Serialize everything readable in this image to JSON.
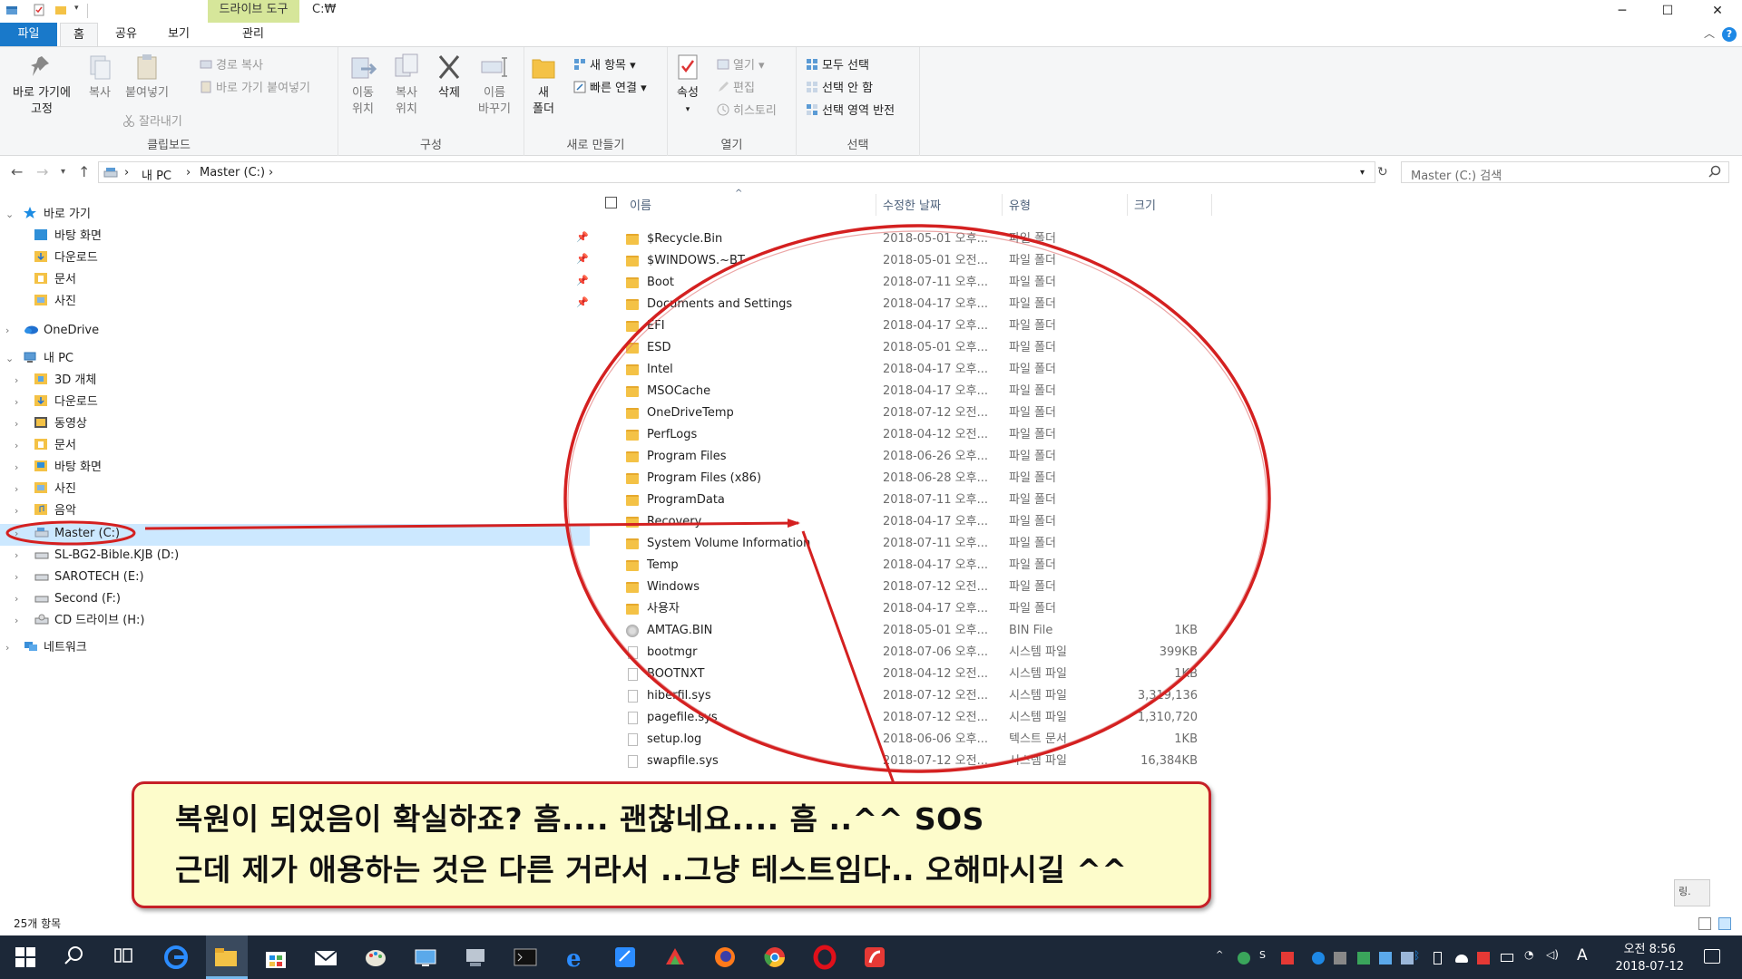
{
  "titlebar": {
    "context_tab": "드라이브 도구",
    "path": "C:₩",
    "minimize": "─",
    "maximize": "☐",
    "close": "✕"
  },
  "tabs": {
    "file": "파일",
    "home": "홈",
    "share": "공유",
    "view": "보기",
    "manage": "관리"
  },
  "ribbon": {
    "clipboard": {
      "label": "클립보드",
      "pin_line1": "바로 가기에",
      "pin_line2": "고정",
      "copy": "복사",
      "paste": "붙여넣기",
      "copy_path": "경로 복사",
      "paste_shortcut": "바로 가기 붙여넣기",
      "cut": "잘라내기"
    },
    "organize": {
      "label": "구성",
      "move_line1": "이동",
      "move_line2": "위치",
      "copyto_line1": "복사",
      "copyto_line2": "위치",
      "delete": "삭제",
      "rename_line1": "이름",
      "rename_line2": "바꾸기"
    },
    "new": {
      "label": "새로 만들기",
      "new_folder_line1": "새",
      "new_folder_line2": "폴더",
      "new_item": "새 항목",
      "easy_access": "빠른 연결"
    },
    "open": {
      "label": "열기",
      "properties": "속성",
      "open": "열기",
      "edit": "편집",
      "history": "히스토리"
    },
    "select": {
      "label": "선택",
      "select_all": "모두 선택",
      "select_none": "선택 안 함",
      "invert": "선택 영역 반전"
    }
  },
  "address": {
    "crumbs": [
      "내 PC",
      "Master (C:)"
    ],
    "search_placeholder": "Master (C:) 검색"
  },
  "navpane": {
    "quick_access": "바로 가기",
    "quick_items": [
      "바탕 화면",
      "다운로드",
      "문서",
      "사진"
    ],
    "onedrive": "OneDrive",
    "this_pc": "내 PC",
    "pc_items": [
      "3D 개체",
      "다운로드",
      "동영상",
      "문서",
      "바탕 화면",
      "사진",
      "음악"
    ],
    "drives": [
      "Master (C:)",
      "SL-BG2-Bible.KJB (D:)",
      "SAROTECH (E:)",
      "Second (F:)",
      "CD 드라이브 (H:)"
    ],
    "network": "네트워크"
  },
  "columns": {
    "name": "이름",
    "date": "수정한 날짜",
    "type": "유형",
    "size": "크기"
  },
  "files": [
    {
      "name": "$Recycle.Bin",
      "date": "2018-05-01 오후...",
      "type": "파일 폴더",
      "size": "",
      "kind": "folder"
    },
    {
      "name": "$WINDOWS.~BT",
      "date": "2018-05-01 오전...",
      "type": "파일 폴더",
      "size": "",
      "kind": "folder"
    },
    {
      "name": "Boot",
      "date": "2018-07-11 오후...",
      "type": "파일 폴더",
      "size": "",
      "kind": "folder"
    },
    {
      "name": "Documents and Settings",
      "date": "2018-04-17 오후...",
      "type": "파일 폴더",
      "size": "",
      "kind": "folder"
    },
    {
      "name": "EFI",
      "date": "2018-04-17 오후...",
      "type": "파일 폴더",
      "size": "",
      "kind": "folder"
    },
    {
      "name": "ESD",
      "date": "2018-05-01 오후...",
      "type": "파일 폴더",
      "size": "",
      "kind": "folder"
    },
    {
      "name": "Intel",
      "date": "2018-04-17 오후...",
      "type": "파일 폴더",
      "size": "",
      "kind": "folder"
    },
    {
      "name": "MSOCache",
      "date": "2018-04-17 오후...",
      "type": "파일 폴더",
      "size": "",
      "kind": "folder"
    },
    {
      "name": "OneDriveTemp",
      "date": "2018-07-12 오전...",
      "type": "파일 폴더",
      "size": "",
      "kind": "folder"
    },
    {
      "name": "PerfLogs",
      "date": "2018-04-12 오전...",
      "type": "파일 폴더",
      "size": "",
      "kind": "folder"
    },
    {
      "name": "Program Files",
      "date": "2018-06-26 오후...",
      "type": "파일 폴더",
      "size": "",
      "kind": "folder"
    },
    {
      "name": "Program Files (x86)",
      "date": "2018-06-28 오후...",
      "type": "파일 폴더",
      "size": "",
      "kind": "folder"
    },
    {
      "name": "ProgramData",
      "date": "2018-07-11 오후...",
      "type": "파일 폴더",
      "size": "",
      "kind": "folder"
    },
    {
      "name": "Recovery",
      "date": "2018-04-17 오후...",
      "type": "파일 폴더",
      "size": "",
      "kind": "folder"
    },
    {
      "name": "System Volume Information",
      "date": "2018-07-11 오후...",
      "type": "파일 폴더",
      "size": "",
      "kind": "folder"
    },
    {
      "name": "Temp",
      "date": "2018-04-17 오후...",
      "type": "파일 폴더",
      "size": "",
      "kind": "folder"
    },
    {
      "name": "Windows",
      "date": "2018-07-12 오전...",
      "type": "파일 폴더",
      "size": "",
      "kind": "folder"
    },
    {
      "name": "사용자",
      "date": "2018-04-17 오후...",
      "type": "파일 폴더",
      "size": "",
      "kind": "folder"
    },
    {
      "name": "AMTAG.BIN",
      "date": "2018-05-01 오후...",
      "type": "BIN File",
      "size": "1KB",
      "kind": "bin"
    },
    {
      "name": "bootmgr",
      "date": "2018-07-06 오후...",
      "type": "시스템 파일",
      "size": "399KB",
      "kind": "doc"
    },
    {
      "name": "BOOTNXT",
      "date": "2018-04-12 오전...",
      "type": "시스템 파일",
      "size": "1KB",
      "kind": "doc"
    },
    {
      "name": "hiberfil.sys",
      "date": "2018-07-12 오전...",
      "type": "시스템 파일",
      "size": "3,319,136",
      "kind": "doc"
    },
    {
      "name": "pagefile.sys",
      "date": "2018-07-12 오전...",
      "type": "시스템 파일",
      "size": "1,310,720",
      "kind": "doc"
    },
    {
      "name": "setup.log",
      "date": "2018-06-06 오후...",
      "type": "텍스트 문서",
      "size": "1KB",
      "kind": "doc"
    },
    {
      "name": "swapfile.sys",
      "date": "2018-07-12 오전...",
      "type": "시스템 파일",
      "size": "16,384KB",
      "kind": "doc"
    }
  ],
  "status": {
    "item_count": "25개 항목"
  },
  "callout": {
    "line1": "복원이 되었음이 확실하죠?  흠.... 괜찮네요.... 흠 ..^^  SOS",
    "line2": "근데 제가 애용하는 것은 다른 거라서 ..그냥 테스트임다.. 오해마시길 ^^"
  },
  "widget": {
    "label": "링."
  },
  "taskbar": {
    "time": "오전 8:56",
    "date": "2018-07-12",
    "ime": "A"
  },
  "colors": {
    "file_tab": "#1979ca",
    "context_tab": "#d6e69a",
    "selection": "#cce8ff",
    "annotation_red": "#d42020",
    "callout_bg": "#fdfccb",
    "taskbar": "#1c2838"
  }
}
